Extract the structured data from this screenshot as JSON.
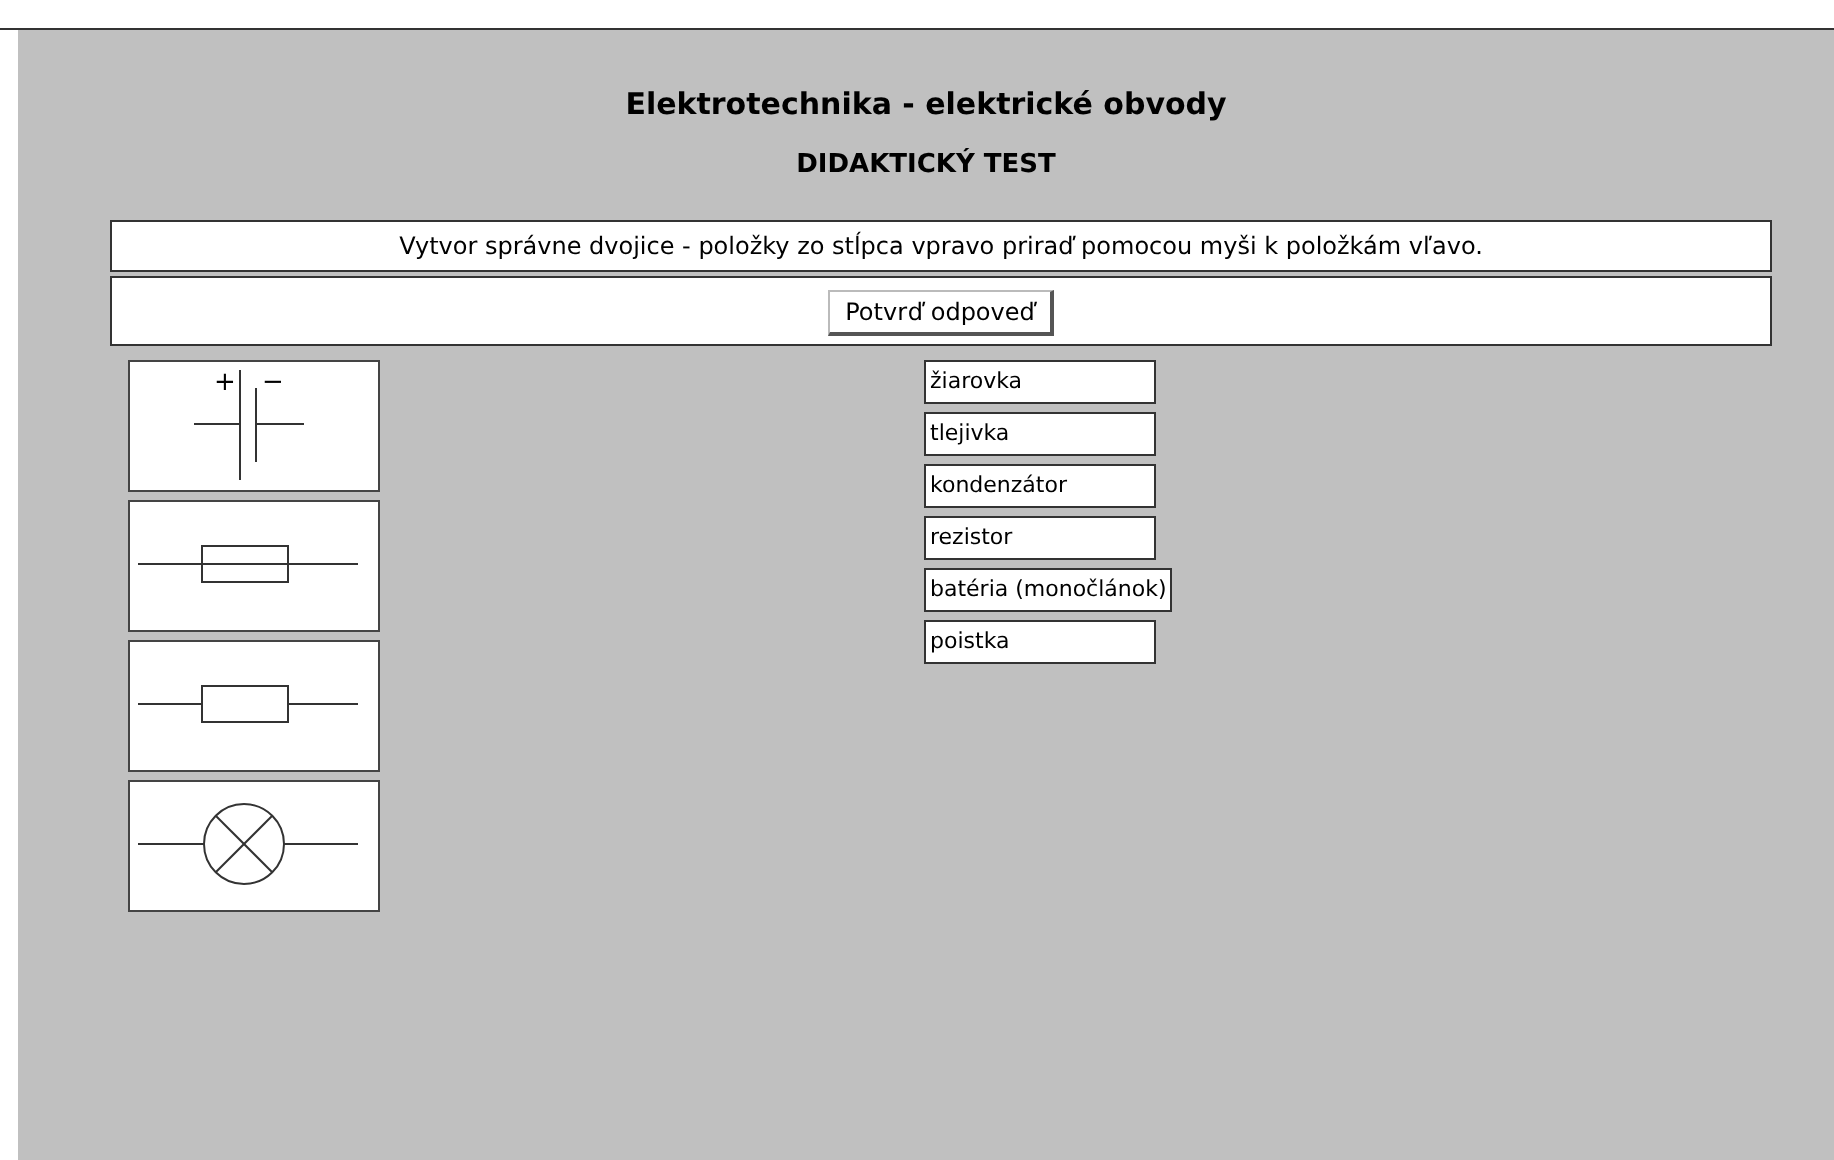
{
  "title": "Elektrotechnika - elektrické obvody",
  "subtitle": "DIDAKTICKÝ TEST",
  "instruction": "Vytvor správne dvojice - položky zo stĺpca vpravo priraď pomocou myši k položkám vľavo.",
  "confirm_button": "Potvrď odpoveď",
  "symbols": [
    {
      "kind": "battery",
      "plus": "+",
      "minus": "−"
    },
    {
      "kind": "fuse"
    },
    {
      "kind": "resistor"
    },
    {
      "kind": "lamp"
    }
  ],
  "answers": [
    "žiarovka",
    "tlejivka",
    "kondenzátor",
    "rezistor",
    "batéria (monočlánok)",
    "poistka"
  ]
}
